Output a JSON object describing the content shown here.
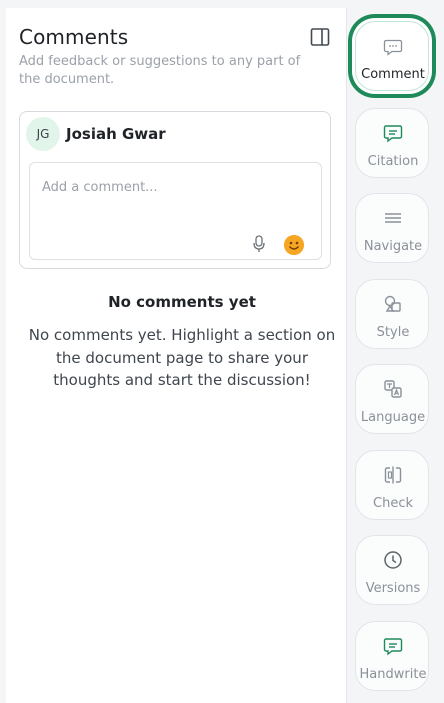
{
  "panel": {
    "title": "Comments",
    "subtitle": "Add feedback or suggestions to any part of the document."
  },
  "composer": {
    "avatar_initials": "JG",
    "user_name": "Josiah Gwar",
    "placeholder": "Add a comment...",
    "mic_icon": "microphone-icon",
    "emoji_icon": "emoji-icon"
  },
  "empty_state": {
    "title": "No comments yet",
    "text": "No comments yet. Highlight a section on the document page to share your thoughts and start the discussion!"
  },
  "rail": {
    "items": [
      {
        "label": "Comment",
        "icon": "comment-icon",
        "active": true
      },
      {
        "label": "Citation",
        "icon": "citation-icon"
      },
      {
        "label": "Navigate",
        "icon": "menu-icon"
      },
      {
        "label": "Style",
        "icon": "style-icon"
      },
      {
        "label": "Language",
        "icon": "language-icon"
      },
      {
        "label": "Check",
        "icon": "check-icon"
      },
      {
        "label": "Versions",
        "icon": "clock-icon"
      },
      {
        "label": "Handwrite",
        "icon": "handwrite-icon"
      }
    ]
  },
  "colors": {
    "accent_green": "#1e8a5a",
    "icon_gray": "#8a9199",
    "avatar_bg": "#e2f5ea",
    "emoji_orange": "#f5a623"
  }
}
